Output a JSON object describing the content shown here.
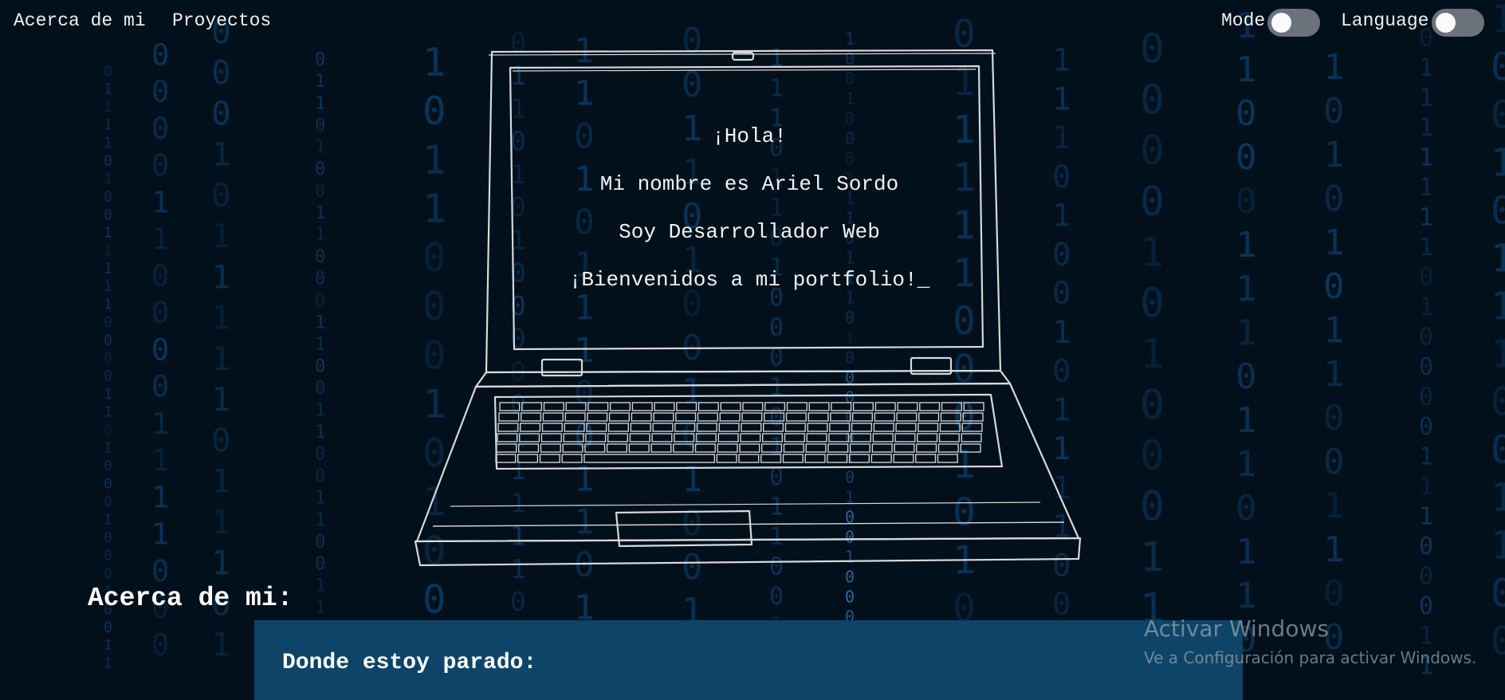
{
  "nav": {
    "links": [
      "Acerca de mi",
      "Proyectos"
    ],
    "mode_label": "Mode",
    "language_label": "Language",
    "mode_on": false,
    "language_on": false
  },
  "hero": {
    "lines": [
      "¡Hola!",
      "Mi nombre es Ariel Sordo",
      "Soy Desarrollador Web",
      "¡Bienvenidos a mi portfolio!"
    ],
    "cursor": "_"
  },
  "about": {
    "title": "Acerca de mi:",
    "card_heading": "Donde estoy parado:"
  },
  "watermark": {
    "title": "Activar Windows",
    "subtitle": "Ve a Configuración para activar Windows."
  },
  "colors": {
    "background": "#02101c",
    "digit": "#0a3d66",
    "digit_bright": "#2b7fc4",
    "card": "#0e4467",
    "toggle": "#6c727c"
  }
}
